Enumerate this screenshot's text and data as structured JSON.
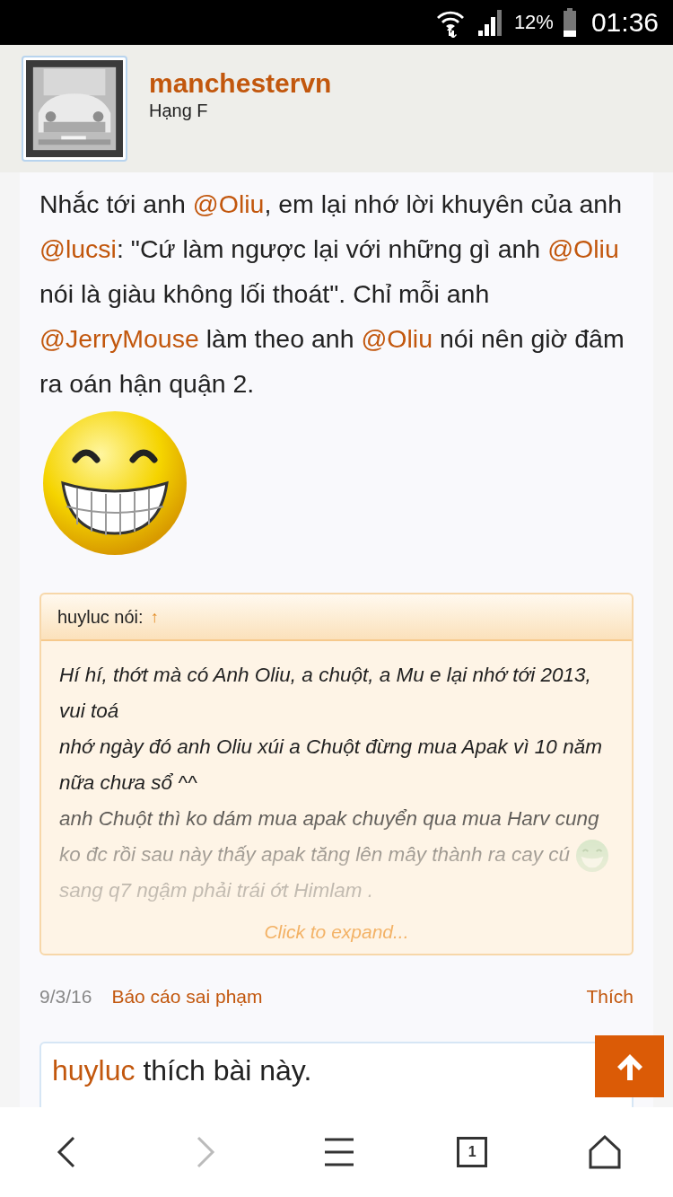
{
  "status_bar": {
    "battery": "12%",
    "time": "01:36"
  },
  "author": {
    "name": "manchestervn",
    "rank": "Hạng F"
  },
  "post": {
    "segments": [
      {
        "kind": "text",
        "text": "Nhắc tới anh "
      },
      {
        "kind": "mention",
        "text": "@Oliu"
      },
      {
        "kind": "text",
        "text": ", em lại nhớ lời khuyên của anh "
      },
      {
        "kind": "mention",
        "text": "@lucsi"
      },
      {
        "kind": "text",
        "text": ": \"Cứ làm ngược lại với những gì anh "
      },
      {
        "kind": "mention",
        "text": "@Oliu"
      },
      {
        "kind": "text",
        "text": " nói là giàu không lối thoát\". Chỉ mỗi anh "
      },
      {
        "kind": "mention",
        "text": "@JerryMouse"
      },
      {
        "kind": "text",
        "text": " làm theo anh "
      },
      {
        "kind": "mention",
        "text": "@Oliu"
      },
      {
        "kind": "text",
        "text": " nói nên giờ đâm ra oán hận quận 2."
      }
    ]
  },
  "quote": {
    "author": "huyluc nói:",
    "jump": "↑",
    "paragraphs": [
      {
        "parts": [
          "Hí hí, thớt mà có Anh Oliu, a chuột, a Mu e lại nhớ tới 2013, vui toá"
        ]
      },
      {
        "parts": [
          "nhớ ngày đó anh Oliu xúi a Chuột đừng mua Apak vì 10 năm nữa chưa sổ ^^"
        ]
      },
      {
        "parts": [
          "anh Chuột thì ko dám mua apak chuyển qua mua Harv cung ko đc rồi sau này thấy apak tăng lên mây thành ra cay cú",
          "sang q7 ngậm phải trái ớt Himlam ."
        ]
      }
    ],
    "expand": "Click to expand..."
  },
  "footer": {
    "date": "9/3/16",
    "report": "Báo cáo sai phạm",
    "like": "Thích"
  },
  "likes": {
    "user": "huyluc",
    "text": "thích bài này."
  },
  "nav": {
    "tab_count": "1"
  }
}
